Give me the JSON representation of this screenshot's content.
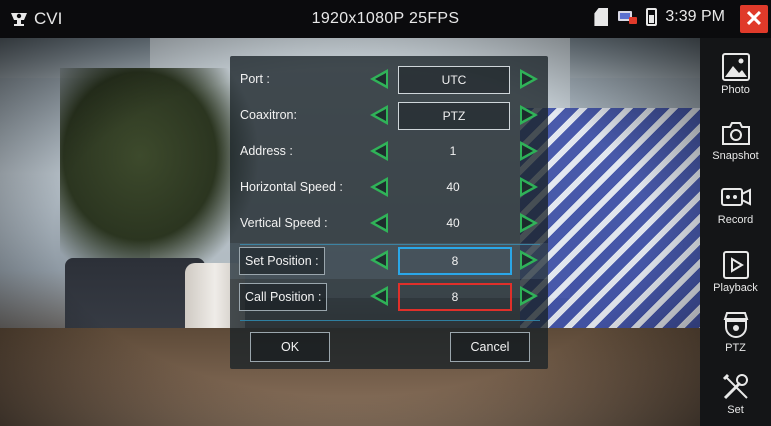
{
  "topbar": {
    "app_name": "CVI",
    "resolution": "1920x1080P 25FPS",
    "time": "3:39 PM",
    "icons": [
      "camera-icon",
      "sd-card-icon",
      "network-icon",
      "battery-icon",
      "close-icon"
    ]
  },
  "sidebar": {
    "items": [
      {
        "label": "Photo",
        "icon": "photo-icon"
      },
      {
        "label": "Snapshot",
        "icon": "snapshot-icon"
      },
      {
        "label": "Record",
        "icon": "record-icon"
      },
      {
        "label": "Playback",
        "icon": "playback-icon"
      },
      {
        "label": "PTZ",
        "icon": "ptz-icon"
      },
      {
        "label": "Set",
        "icon": "settings-icon"
      }
    ]
  },
  "dialog": {
    "rows": [
      {
        "label": "Port :",
        "value": "UTC"
      },
      {
        "label": "Coaxitron:",
        "value": "PTZ"
      },
      {
        "label": "Address :",
        "value": "1"
      },
      {
        "label": "Horizontal Speed :",
        "value": "40"
      },
      {
        "label": "Vertical Speed :",
        "value": "40"
      },
      {
        "label": "Set Position :",
        "value": "8"
      },
      {
        "label": "Call Position :",
        "value": "8"
      }
    ],
    "ok_label": "OK",
    "cancel_label": "Cancel"
  },
  "colors": {
    "arrow": "#2fbf5a",
    "focus_blue": "#2aa7e8",
    "focus_red": "#e0302a",
    "close": "#e03a2a"
  }
}
